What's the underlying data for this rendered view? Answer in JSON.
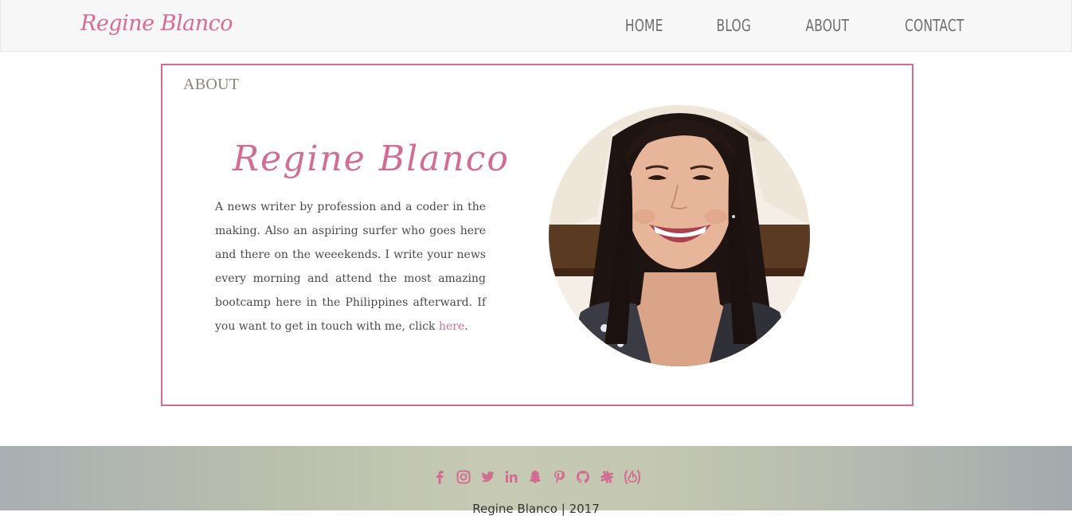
{
  "nav": {
    "brand": "Regine Blanco",
    "links": [
      "HOME",
      "BLOG",
      "ABOUT",
      "CONTACT"
    ]
  },
  "about": {
    "heading": "ABOUT",
    "name": "Regine Blanco",
    "bio": "A news writer by profession and a coder in the making. Also an aspiring surfer who goes here and there on the weeekends. I write your news every morning and attend the most amazing bootcamp here in the Philippines afterward. If you want to get in touch with me, click ",
    "bio_link": "here",
    "bio_end": "."
  },
  "footer": {
    "social_icons": [
      "facebook-icon",
      "instagram-icon",
      "twitter-icon",
      "linkedin-icon",
      "snapchat-icon",
      "pinterest-icon",
      "github-icon",
      "slack-icon",
      "freecodecamp-icon"
    ],
    "copyright": "Regine Blanco | 2017"
  },
  "colors": {
    "accent": "#d16c92",
    "nav_bg": "#f7f7f7",
    "nav_text": "#6d6d6d",
    "heading": "#8d8579"
  }
}
